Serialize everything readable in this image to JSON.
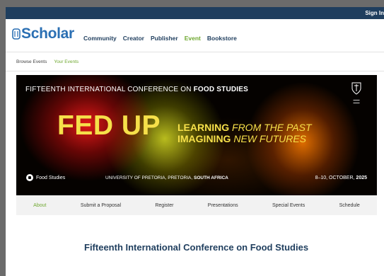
{
  "topbar": {
    "signin": "Sign In"
  },
  "header": {
    "logo_text": "Scholar",
    "nav": [
      {
        "label": "Community",
        "active": false
      },
      {
        "label": "Creator",
        "active": false
      },
      {
        "label": "Publisher",
        "active": false
      },
      {
        "label": "Event",
        "active": true
      },
      {
        "label": "Bookstore",
        "active": false
      }
    ]
  },
  "subnav": {
    "browse": "Browse Events",
    "yours": "Your Events"
  },
  "banner": {
    "top_prefix": "FIFTEENTH INTERNATIONAL CONFERENCE ON ",
    "top_strong": "FOOD STUDIES",
    "headline": "FED UP",
    "theme_line1_strong": "LEARNING",
    "theme_line1_italic": " FROM THE PAST",
    "theme_line2_strong": "IMAGINING",
    "theme_line2_italic": " NEW FUTURES",
    "brand": "Food Studies",
    "venue_prefix": "UNIVERSITY OF PRETORIA, PRETORIA, ",
    "venue_strong": "SOUTH AFRICA",
    "dates_prefix": "8–10, OCTOBER, ",
    "dates_strong": "2025",
    "colors": {
      "headline": "#f6e04a",
      "red_glow": "#eb1919",
      "yellow_glow": "#d7dc23",
      "orange_glow": "#eb7300"
    }
  },
  "conference_nav": [
    {
      "label": "About",
      "active": true
    },
    {
      "label": "Submit a Proposal",
      "active": false
    },
    {
      "label": "Register",
      "active": false
    },
    {
      "label": "Presentations",
      "active": false
    },
    {
      "label": "Special Events",
      "active": false
    },
    {
      "label": "Schedule",
      "active": false
    }
  ],
  "content": {
    "title": "Fifteenth International Conference on Food Studies"
  },
  "colors": {
    "topbar": "#1f3e5e",
    "accent_green": "#6fa830",
    "logo_blue": "#2a6fb3"
  }
}
